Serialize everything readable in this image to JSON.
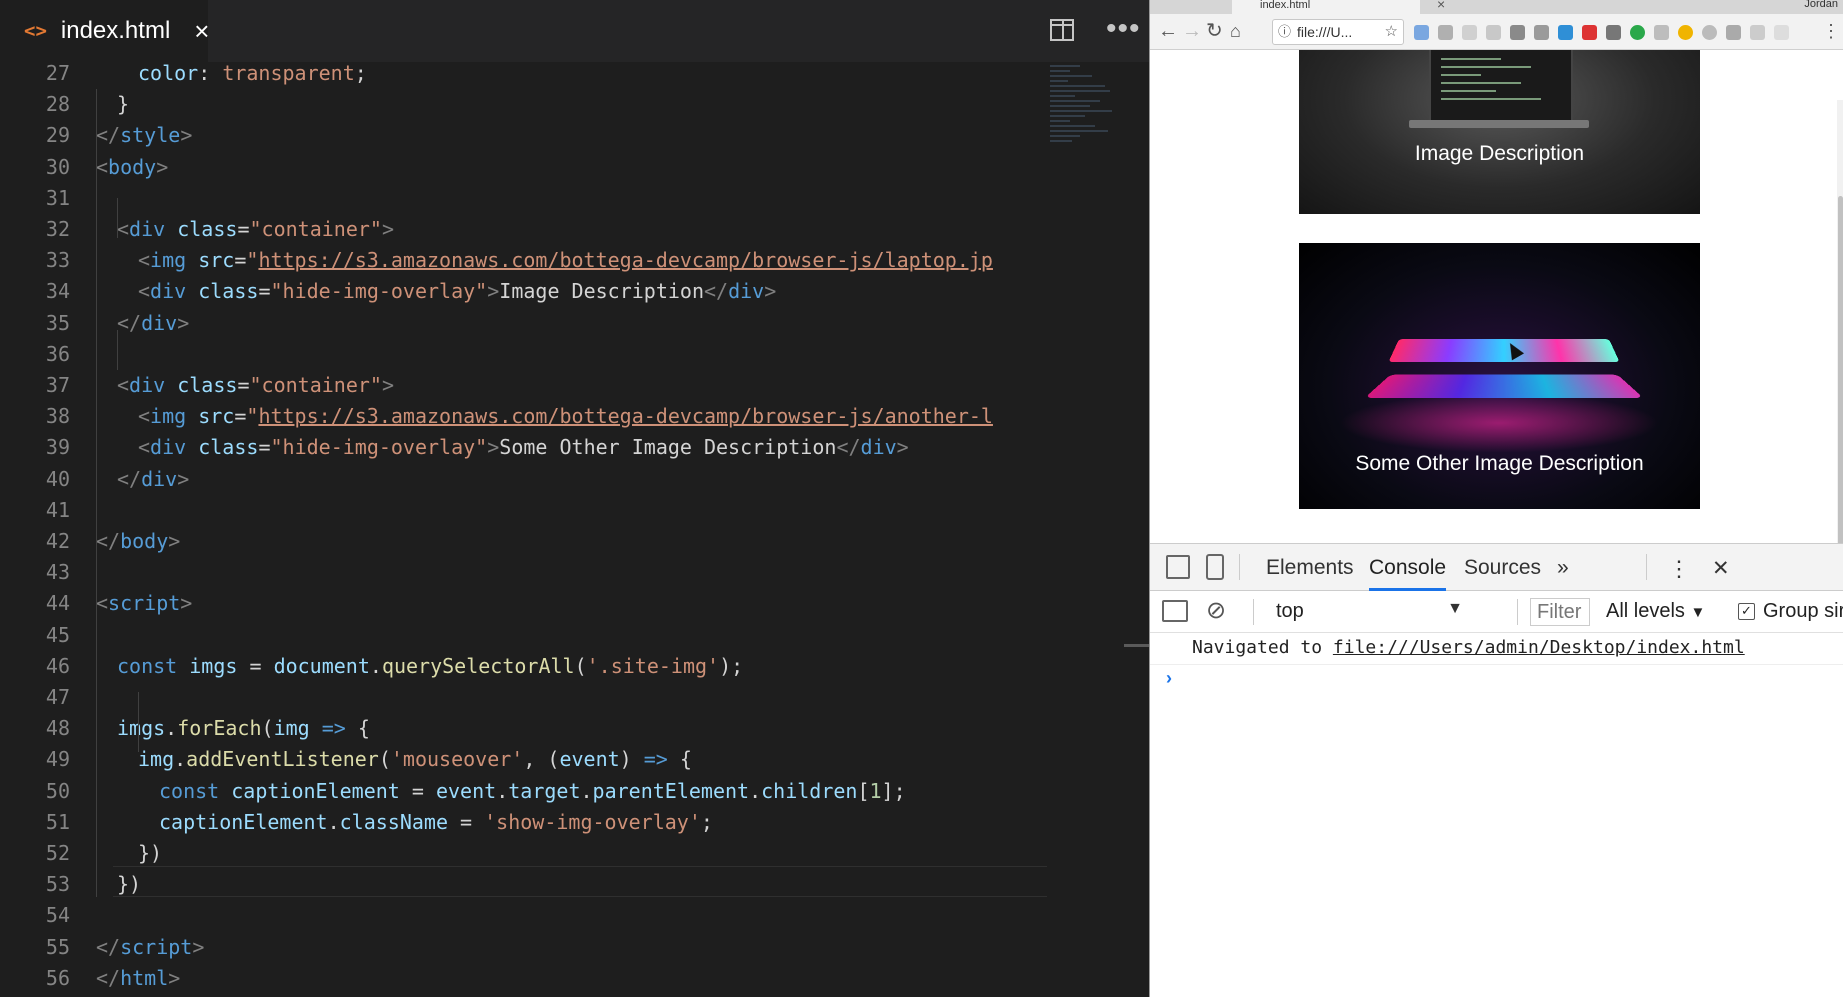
{
  "editor": {
    "tab_icon": "<>",
    "tab_name": "index.html",
    "tab_close": "×",
    "more": "•••",
    "lines": [
      {
        "num": "27",
        "tokens": [
          {
            "c": "at",
            "t": "color"
          },
          {
            "c": "tx",
            "t": ": "
          },
          {
            "c": "st",
            "t": "transparent"
          },
          {
            "c": "tx",
            "t": ";"
          }
        ]
      },
      {
        "num": "28",
        "tokens": [
          {
            "c": "tx",
            "t": "}"
          }
        ]
      },
      {
        "num": "29",
        "tokens": [
          {
            "c": "tg",
            "t": "</"
          },
          {
            "c": "tn",
            "t": "style"
          },
          {
            "c": "tg",
            "t": ">"
          }
        ]
      },
      {
        "num": "30",
        "tokens": [
          {
            "c": "tg",
            "t": "<"
          },
          {
            "c": "tn",
            "t": "body"
          },
          {
            "c": "tg",
            "t": ">"
          }
        ]
      },
      {
        "num": "31",
        "tokens": []
      },
      {
        "num": "32",
        "tokens": [
          {
            "c": "tg",
            "t": "<"
          },
          {
            "c": "tn",
            "t": "div"
          },
          {
            "c": "tx",
            "t": " "
          },
          {
            "c": "at",
            "t": "class"
          },
          {
            "c": "tx",
            "t": "="
          },
          {
            "c": "st",
            "t": "\"container\""
          },
          {
            "c": "tg",
            "t": ">"
          }
        ]
      },
      {
        "num": "33",
        "tokens": [
          {
            "c": "tg",
            "t": "<"
          },
          {
            "c": "tn",
            "t": "img"
          },
          {
            "c": "tx",
            "t": " "
          },
          {
            "c": "at",
            "t": "src"
          },
          {
            "c": "tx",
            "t": "="
          },
          {
            "c": "st",
            "t": "\""
          },
          {
            "c": "url",
            "t": "https://s3.amazonaws.com/bottega-devcamp/browser-js/laptop.jp"
          }
        ]
      },
      {
        "num": "34",
        "tokens": [
          {
            "c": "tg",
            "t": "<"
          },
          {
            "c": "tn",
            "t": "div"
          },
          {
            "c": "tx",
            "t": " "
          },
          {
            "c": "at",
            "t": "class"
          },
          {
            "c": "tx",
            "t": "="
          },
          {
            "c": "st",
            "t": "\"hide-img-overlay\""
          },
          {
            "c": "tg",
            "t": ">"
          },
          {
            "c": "tx",
            "t": "Image Description"
          },
          {
            "c": "tg",
            "t": "</"
          },
          {
            "c": "tn",
            "t": "div"
          },
          {
            "c": "tg",
            "t": ">"
          }
        ]
      },
      {
        "num": "35",
        "tokens": [
          {
            "c": "tg",
            "t": "</"
          },
          {
            "c": "tn",
            "t": "div"
          },
          {
            "c": "tg",
            "t": ">"
          }
        ]
      },
      {
        "num": "36",
        "tokens": []
      },
      {
        "num": "37",
        "tokens": [
          {
            "c": "tg",
            "t": "<"
          },
          {
            "c": "tn",
            "t": "div"
          },
          {
            "c": "tx",
            "t": " "
          },
          {
            "c": "at",
            "t": "class"
          },
          {
            "c": "tx",
            "t": "="
          },
          {
            "c": "st",
            "t": "\"container\""
          },
          {
            "c": "tg",
            "t": ">"
          }
        ]
      },
      {
        "num": "38",
        "tokens": [
          {
            "c": "tg",
            "t": "<"
          },
          {
            "c": "tn",
            "t": "img"
          },
          {
            "c": "tx",
            "t": " "
          },
          {
            "c": "at",
            "t": "src"
          },
          {
            "c": "tx",
            "t": "="
          },
          {
            "c": "st",
            "t": "\""
          },
          {
            "c": "url",
            "t": "https://s3.amazonaws.com/bottega-devcamp/browser-js/another-l"
          }
        ]
      },
      {
        "num": "39",
        "tokens": [
          {
            "c": "tg",
            "t": "<"
          },
          {
            "c": "tn",
            "t": "div"
          },
          {
            "c": "tx",
            "t": " "
          },
          {
            "c": "at",
            "t": "class"
          },
          {
            "c": "tx",
            "t": "="
          },
          {
            "c": "st",
            "t": "\"hide-img-overlay\""
          },
          {
            "c": "tg",
            "t": ">"
          },
          {
            "c": "tx",
            "t": "Some Other Image Description"
          },
          {
            "c": "tg",
            "t": "</"
          },
          {
            "c": "tn",
            "t": "div"
          },
          {
            "c": "tg",
            "t": ">"
          }
        ]
      },
      {
        "num": "40",
        "tokens": [
          {
            "c": "tg",
            "t": "</"
          },
          {
            "c": "tn",
            "t": "div"
          },
          {
            "c": "tg",
            "t": ">"
          }
        ]
      },
      {
        "num": "41",
        "tokens": []
      },
      {
        "num": "42",
        "tokens": [
          {
            "c": "tg",
            "t": "</"
          },
          {
            "c": "tn",
            "t": "body"
          },
          {
            "c": "tg",
            "t": ">"
          }
        ]
      },
      {
        "num": "43",
        "tokens": []
      },
      {
        "num": "44",
        "tokens": [
          {
            "c": "tg",
            "t": "<"
          },
          {
            "c": "tn",
            "t": "script"
          },
          {
            "c": "tg",
            "t": ">"
          }
        ]
      },
      {
        "num": "45",
        "tokens": []
      },
      {
        "num": "46",
        "tokens": [
          {
            "c": "kw",
            "t": "const"
          },
          {
            "c": "tx",
            "t": " "
          },
          {
            "c": "vr",
            "t": "imgs"
          },
          {
            "c": "tx",
            "t": " = "
          },
          {
            "c": "vr",
            "t": "document"
          },
          {
            "c": "tx",
            "t": "."
          },
          {
            "c": "fn",
            "t": "querySelectorAll"
          },
          {
            "c": "tx",
            "t": "("
          },
          {
            "c": "st",
            "t": "'.site-img'"
          },
          {
            "c": "tx",
            "t": ");"
          }
        ]
      },
      {
        "num": "47",
        "tokens": []
      },
      {
        "num": "48",
        "tokens": [
          {
            "c": "vr",
            "t": "imgs"
          },
          {
            "c": "tx",
            "t": "."
          },
          {
            "c": "fn",
            "t": "forEach"
          },
          {
            "c": "tx",
            "t": "("
          },
          {
            "c": "vr",
            "t": "img"
          },
          {
            "c": "tx",
            "t": " "
          },
          {
            "c": "kw",
            "t": "=>"
          },
          {
            "c": "tx",
            "t": " {"
          }
        ]
      },
      {
        "num": "49",
        "tokens": [
          {
            "c": "vr",
            "t": "img"
          },
          {
            "c": "tx",
            "t": "."
          },
          {
            "c": "fn",
            "t": "addEventListener"
          },
          {
            "c": "tx",
            "t": "("
          },
          {
            "c": "st",
            "t": "'mouseover'"
          },
          {
            "c": "tx",
            "t": ", ("
          },
          {
            "c": "vr",
            "t": "event"
          },
          {
            "c": "tx",
            "t": ") "
          },
          {
            "c": "kw",
            "t": "=>"
          },
          {
            "c": "tx",
            "t": " {"
          }
        ]
      },
      {
        "num": "50",
        "tokens": [
          {
            "c": "kw",
            "t": "const"
          },
          {
            "c": "tx",
            "t": " "
          },
          {
            "c": "vr",
            "t": "captionElement"
          },
          {
            "c": "tx",
            "t": " = "
          },
          {
            "c": "vr",
            "t": "event"
          },
          {
            "c": "tx",
            "t": "."
          },
          {
            "c": "vr",
            "t": "target"
          },
          {
            "c": "tx",
            "t": "."
          },
          {
            "c": "vr",
            "t": "parentElement"
          },
          {
            "c": "tx",
            "t": "."
          },
          {
            "c": "vr",
            "t": "children"
          },
          {
            "c": "tx",
            "t": "["
          },
          {
            "c": "nm",
            "t": "1"
          },
          {
            "c": "tx",
            "t": "];"
          }
        ]
      },
      {
        "num": "51",
        "tokens": [
          {
            "c": "vr",
            "t": "captionElement"
          },
          {
            "c": "tx",
            "t": "."
          },
          {
            "c": "vr",
            "t": "className"
          },
          {
            "c": "tx",
            "t": " = "
          },
          {
            "c": "st",
            "t": "'show-img-overlay'"
          },
          {
            "c": "tx",
            "t": ";"
          }
        ]
      },
      {
        "num": "52",
        "tokens": [
          {
            "c": "tx",
            "t": "})"
          }
        ]
      },
      {
        "num": "53",
        "tokens": [
          {
            "c": "tx",
            "t": "})"
          }
        ]
      },
      {
        "num": "54",
        "tokens": []
      },
      {
        "num": "55",
        "tokens": [
          {
            "c": "tg",
            "t": "</"
          },
          {
            "c": "tn",
            "t": "script"
          },
          {
            "c": "tg",
            "t": ">"
          }
        ]
      },
      {
        "num": "56",
        "tokens": [
          {
            "c": "tg",
            "t": "</"
          },
          {
            "c": "tn",
            "t": "html"
          },
          {
            "c": "tg",
            "t": ">"
          }
        ]
      }
    ]
  },
  "browser": {
    "tab_title": "index.html",
    "tab_close": "×",
    "profile": "Jordan",
    "address": "file:///U...",
    "page": {
      "captions": [
        "Image Description",
        "Some Other Image Description"
      ]
    },
    "devtools": {
      "tabs": [
        "Elements",
        "Console",
        "Sources"
      ],
      "more_tabs": "»",
      "context": "top",
      "filter_placeholder": "Filter",
      "levels": "All levels",
      "group_label": "Group sir",
      "log_prefix": "Navigated to ",
      "log_link": "file:///Users/admin/Desktop/index.html",
      "prompt": "›",
      "close": "✕"
    }
  },
  "colors": {
    "editor_bg": "#1e1e1e",
    "tag": "#569cd6",
    "attr": "#9cdcfe",
    "string": "#ce9178",
    "function": "#dcdcaa",
    "devtools_accent": "#1a73e8"
  }
}
